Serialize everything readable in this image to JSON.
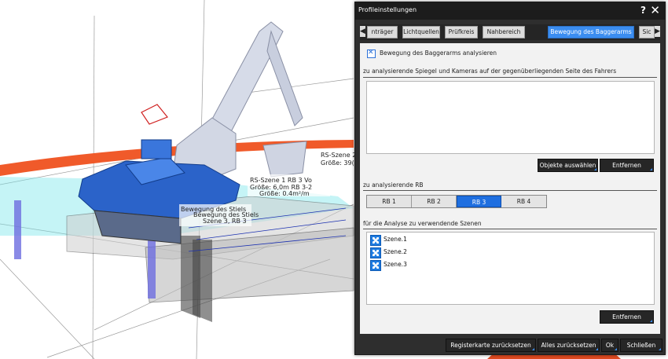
{
  "scene": {
    "labels": [
      {
        "text": "RS-Szene 2"
      },
      {
        "text": "Größe: 39("
      },
      {
        "text": "RS-Szene 1 RB 3 Vo"
      },
      {
        "text": "Größe: 6,0m RB 3-2"
      },
      {
        "text": "Größe: 0.4m²/m"
      },
      {
        "text": "Bewegung des Stiels"
      },
      {
        "text": "Bewegung des Stiels"
      },
      {
        "text": "Szene 3, RB 3"
      }
    ]
  },
  "dialog": {
    "title": "Profileinstellungen",
    "help": "?",
    "close": "✕",
    "tab_left_arrow": "◀",
    "tab_right_arrow": "▶",
    "tabs": [
      {
        "label": "nträger",
        "active": false
      },
      {
        "label": "Lichtquellen",
        "active": false
      },
      {
        "label": "Prüfkreis",
        "active": false
      },
      {
        "label": "Nahbereich",
        "active": false
      },
      {
        "label": "Bewegung des Baggerarms",
        "active": true
      },
      {
        "label": "Sic",
        "active": false
      }
    ],
    "analyze_checkbox_label": "Bewegung des Baggerarms analysieren",
    "analyze_checked": true,
    "mirrors_section_label": "zu analysierende Spiegel und Kameras auf der gegenüberliegenden Seite des Fahrers",
    "select_objects_button": "Objekte auswählen",
    "remove_button_1": "Entfernen",
    "rb_section_label": "zu analysierende RB",
    "rb_options": [
      {
        "label": "RB 1",
        "active": false
      },
      {
        "label": "RB 2",
        "active": false
      },
      {
        "label": "RB 3",
        "active": true
      },
      {
        "label": "RB 4",
        "active": false
      }
    ],
    "scenes_section_label": "für die Analyse zu verwendende Szenen",
    "scenes": [
      {
        "name": "Szene.1"
      },
      {
        "name": "Szene.2"
      },
      {
        "name": "Szene.3"
      }
    ],
    "remove_button_2": "Entfernen",
    "footer": {
      "reset_tab": "Registerkarte zurücksetzen",
      "reset_all": "Alles zurücksetzen",
      "ok": "Ok",
      "close": "Schließen"
    }
  }
}
